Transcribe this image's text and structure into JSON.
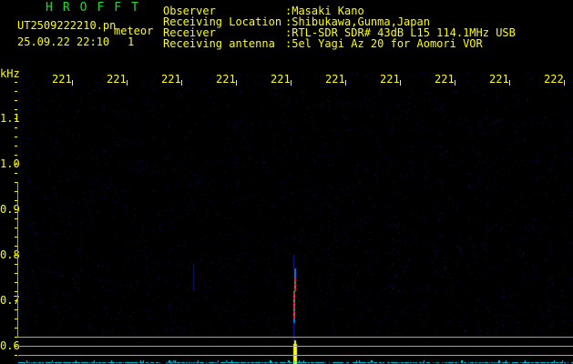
{
  "header": {
    "app_title": "HROFFT",
    "filename": "UT2509222210.pn",
    "mode": "meteor",
    "datetime": "25.09.22 22:10",
    "counter": "1",
    "info_labels": [
      "Observer",
      "Receiving Location",
      "Receiver",
      "Receiving antenna"
    ],
    "info_values": [
      ":Masaki Kano",
      ":Shibukawa,Gunma,Japan",
      ":RTL-SDR SDR# 43dB L15 114.1MHz USB",
      ":5el Yagi Az 20 for Aomori VOR"
    ]
  },
  "axis": {
    "unit": "kHz",
    "x_ticks": [
      "2211",
      "2212",
      "2213",
      "2214",
      "2215",
      "2216",
      "2217",
      "2218",
      "2219",
      "2220"
    ],
    "y_ticks": [
      "1.1",
      "1.0",
      "0.9",
      "0.8",
      "0.7",
      "0.6"
    ]
  },
  "colors": {
    "text": "#ffff00",
    "title": "#22dd22",
    "grid": "#a0a0a0",
    "noise": "#0a0a50"
  }
}
